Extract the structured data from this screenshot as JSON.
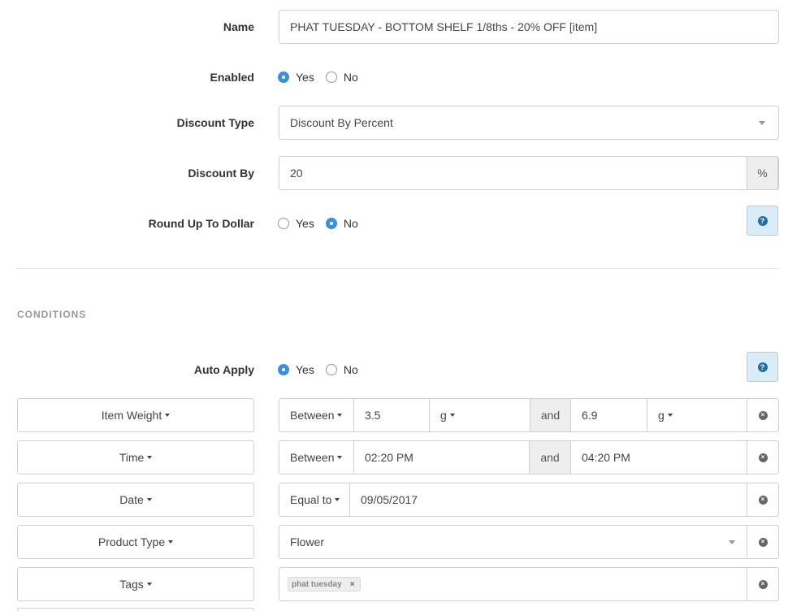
{
  "form": {
    "name_label": "Name",
    "name_value": "PHAT TUESDAY -  BOTTOM SHELF 1/8ths - 20% OFF [item]",
    "enabled_label": "Enabled",
    "enabled_yes": "Yes",
    "enabled_no": "No",
    "enabled_selected": "Yes",
    "discount_type_label": "Discount Type",
    "discount_type_value": "Discount By Percent",
    "discount_by_label": "Discount By",
    "discount_by_value": "20",
    "discount_by_unit": "%",
    "round_label": "Round Up To Dollar",
    "round_yes": "Yes",
    "round_no": "No",
    "round_selected": "No",
    "help_icon": "question-circle-icon"
  },
  "conditions": {
    "section_title": "CONDITIONS",
    "auto_apply_label": "Auto Apply",
    "auto_apply_yes": "Yes",
    "auto_apply_no": "No",
    "auto_apply_selected": "Yes",
    "rows": [
      {
        "field": "Item Weight",
        "operator": "Between",
        "value1": "3.5",
        "unit1": "g",
        "joiner": "and",
        "value2": "6.9",
        "unit2": "g"
      },
      {
        "field": "Time",
        "operator": "Between",
        "value1": "02:20 PM",
        "joiner": "and",
        "value2": "04:20 PM"
      },
      {
        "field": "Date",
        "operator": "Equal to",
        "value1": "09/05/2017"
      },
      {
        "field": "Product Type",
        "value1": "Flower"
      },
      {
        "field": "Tags",
        "tag": "phat tuesday",
        "tag_remove": "×"
      }
    ],
    "clear_icon": "close-circle-icon",
    "clear_glyph": "×"
  },
  "colors": {
    "accent": "#3b8fe0",
    "help_bg": "#d9ecf8",
    "addon_bg": "#eeeeee"
  }
}
